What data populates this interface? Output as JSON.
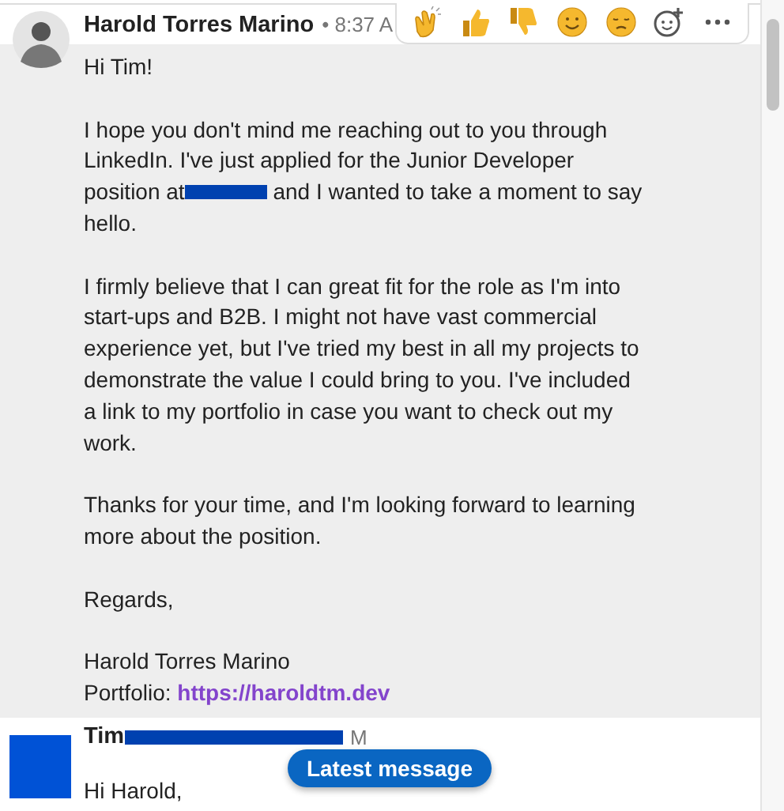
{
  "reactions": [
    {
      "kind": "clap"
    },
    {
      "kind": "thumbs_up"
    },
    {
      "kind": "thumbs_down"
    },
    {
      "kind": "smile"
    },
    {
      "kind": "sad"
    },
    {
      "kind": "add"
    },
    {
      "kind": "more"
    }
  ],
  "messages": [
    {
      "avatar": {
        "kind": "photo"
      },
      "highlighted": true,
      "sender": [
        {
          "kind": "text",
          "text": "Harold Torres Marino"
        }
      ],
      "time": "• 8:37 A",
      "paragraphs": [
        [
          [
            {
              "kind": "text",
              "text": "Hi Tim!"
            }
          ]
        ],
        [
          [
            {
              "kind": "text",
              "text": "I hope you don't mind me reaching out to you through"
            }
          ],
          [
            {
              "kind": "text",
              "text": "LinkedIn. I've just applied for the Junior Developer"
            }
          ],
          [
            {
              "kind": "text",
              "text": "position at"
            },
            {
              "kind": "redaction"
            },
            {
              "kind": "text",
              "text": " and I wanted to take a moment to say"
            }
          ],
          [
            {
              "kind": "text",
              "text": "hello."
            }
          ]
        ],
        [
          [
            {
              "kind": "text",
              "text": "I firmly believe that I can great fit for the role as I'm into"
            }
          ],
          [
            {
              "kind": "text",
              "text": "start-ups and B2B. I might not have vast commercial"
            }
          ],
          [
            {
              "kind": "text",
              "text": "experience yet, but I've tried my best in all my projects to"
            }
          ],
          [
            {
              "kind": "text",
              "text": "demonstrate the value I could bring to you. I've included"
            }
          ],
          [
            {
              "kind": "text",
              "text": "a link to my portfolio in case you want to check out my"
            }
          ],
          [
            {
              "kind": "text",
              "text": "work."
            }
          ]
        ],
        [
          [
            {
              "kind": "text",
              "text": "Thanks for your time, and I'm looking forward to learning"
            }
          ],
          [
            {
              "kind": "text",
              "text": "more about the position."
            }
          ]
        ],
        [
          [
            {
              "kind": "text",
              "text": "Regards,"
            }
          ]
        ],
        [
          [
            {
              "kind": "text",
              "text": "Harold Torres Marino"
            }
          ],
          [
            {
              "kind": "text",
              "text": "Portfolio: "
            },
            {
              "kind": "link",
              "text": "https://haroldtm.dev"
            }
          ]
        ]
      ]
    },
    {
      "avatar": {
        "kind": "redacted"
      },
      "highlighted": false,
      "sender": [
        {
          "kind": "text",
          "text": "Tim"
        },
        {
          "kind": "redaction"
        }
      ],
      "time": "M",
      "paragraphs": [
        [
          [
            {
              "kind": "text",
              "text": "Hi Harold,"
            }
          ]
        ]
      ]
    }
  ],
  "latest_button": "Latest message"
}
